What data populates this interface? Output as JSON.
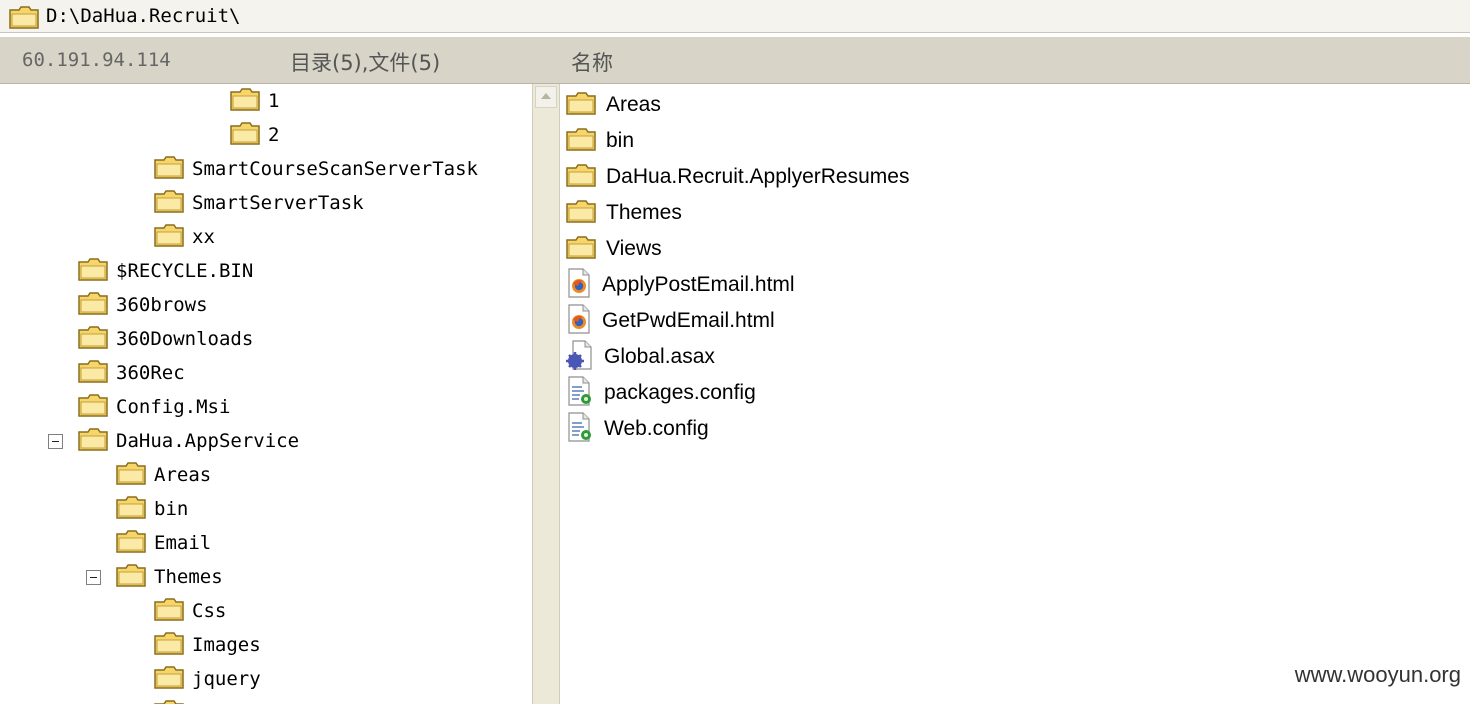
{
  "pathbar": {
    "path": "D:\\DaHua.Recruit\\"
  },
  "header": {
    "host": "60.191.94.114",
    "counts": "目录(5),文件(5)",
    "name_column": "名称"
  },
  "tree": [
    {
      "label": "1",
      "level": 4,
      "expanded": false,
      "has_expander": false
    },
    {
      "label": "2",
      "level": 4,
      "expanded": false,
      "has_expander": false
    },
    {
      "label": "SmartCourseScanServerTask",
      "level": 3,
      "expanded": false,
      "has_expander": false
    },
    {
      "label": "SmartServerTask",
      "level": 3,
      "expanded": false,
      "has_expander": false
    },
    {
      "label": "xx",
      "level": 3,
      "expanded": false,
      "has_expander": false
    },
    {
      "label": "$RECYCLE.BIN",
      "level": 1,
      "expanded": false,
      "has_expander": false
    },
    {
      "label": "360brows",
      "level": 1,
      "expanded": false,
      "has_expander": false
    },
    {
      "label": "360Downloads",
      "level": 1,
      "expanded": false,
      "has_expander": false
    },
    {
      "label": "360Rec",
      "level": 1,
      "expanded": false,
      "has_expander": false
    },
    {
      "label": "Config.Msi",
      "level": 1,
      "expanded": false,
      "has_expander": false
    },
    {
      "label": "DaHua.AppService",
      "level": 1,
      "expanded": true,
      "has_expander": true
    },
    {
      "label": "Areas",
      "level": 2,
      "expanded": false,
      "has_expander": false
    },
    {
      "label": "bin",
      "level": 2,
      "expanded": false,
      "has_expander": false
    },
    {
      "label": "Email",
      "level": 2,
      "expanded": false,
      "has_expander": false
    },
    {
      "label": "Themes",
      "level": 2,
      "expanded": true,
      "has_expander": true
    },
    {
      "label": "Css",
      "level": 3,
      "expanded": false,
      "has_expander": false
    },
    {
      "label": "Images",
      "level": 3,
      "expanded": false,
      "has_expander": false
    },
    {
      "label": "jquery",
      "level": 3,
      "expanded": false,
      "has_expander": false
    },
    {
      "label": "",
      "level": 3,
      "expanded": false,
      "has_expander": false
    }
  ],
  "files": [
    {
      "name": "Areas",
      "icon": "folder-icon"
    },
    {
      "name": "bin",
      "icon": "folder-icon"
    },
    {
      "name": "DaHua.Recruit.ApplyerResumes",
      "icon": "folder-icon"
    },
    {
      "name": "Themes",
      "icon": "folder-icon"
    },
    {
      "name": "Views",
      "icon": "folder-icon"
    },
    {
      "name": "ApplyPostEmail.html",
      "icon": "html-file-icon"
    },
    {
      "name": "GetPwdEmail.html",
      "icon": "html-file-icon"
    },
    {
      "name": "Global.asax",
      "icon": "asax-file-icon"
    },
    {
      "name": "packages.config",
      "icon": "config-file-icon"
    },
    {
      "name": "Web.config",
      "icon": "config-file-icon"
    }
  ],
  "watermark": "www.wooyun.org",
  "colors": {
    "folder": "#f6d66a",
    "folder_outline": "#b58b1a",
    "header_bg": "#d8d4c8"
  }
}
